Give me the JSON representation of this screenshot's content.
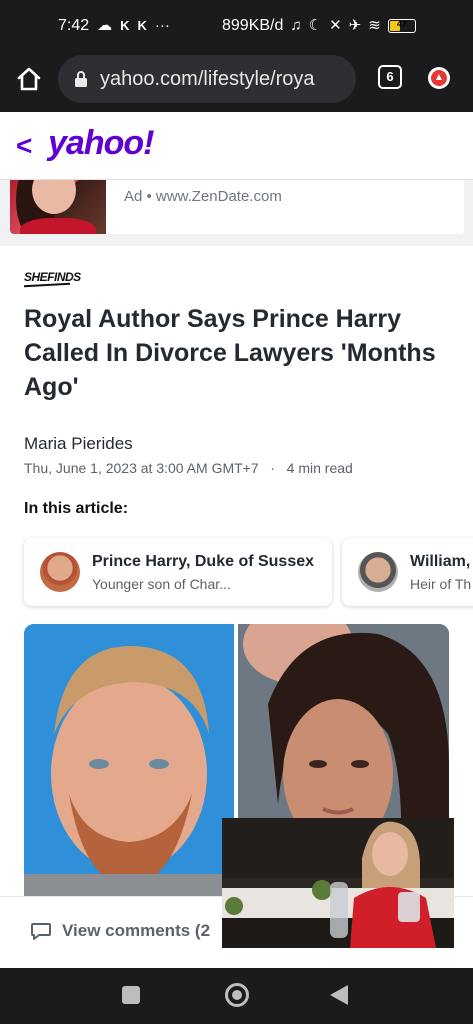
{
  "statusbar": {
    "time": "7:42",
    "left_icons": [
      "cloud-icon",
      "k-icon",
      "k-icon",
      "more-dots-icon"
    ],
    "net_speed": "899KB/d",
    "battery_level": "47"
  },
  "browser": {
    "url": "yahoo.com/lifestyle/roya",
    "tab_count": "6"
  },
  "site": {
    "back_label": "<",
    "logo": "yahoo!"
  },
  "ad": {
    "text": "Ad • www.ZenDate.com"
  },
  "article": {
    "source": "SHEFINDS",
    "headline": "Royal Author Says Prince Harry Called In Divorce Lawyers 'Months Ago'",
    "author": "Maria Pierides",
    "date": "Thu, June 1, 2023 at 3:00 AM GMT+7",
    "read_time": "4 min read",
    "in_this_article": "In this article:",
    "entities": [
      {
        "name": "Prince Harry, Duke of Sussex",
        "desc": "Younger son of Char..."
      },
      {
        "name": "William,",
        "desc": "Heir of Th"
      }
    ]
  },
  "footer": {
    "comments": "View comments (2"
  }
}
